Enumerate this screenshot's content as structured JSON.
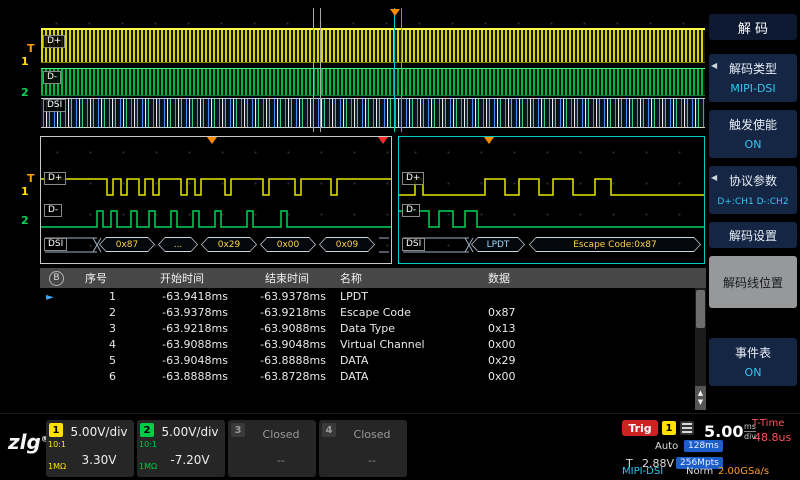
{
  "icons": {
    "scroll_up": "▲",
    "scroll_down": "▼",
    "row_pointer": "►",
    "submenu_arrow": "◀",
    "bus_badge": "B"
  },
  "wave": {
    "ch1": "D+",
    "ch2": "D-",
    "bus": "DSI",
    "t_marker": "T",
    "ch1_num": "1",
    "ch2_num": "2"
  },
  "zoom_left": {
    "ch1": "D+",
    "ch2": "D-",
    "bus": "DSI",
    "values": [
      "0x87",
      "...",
      "0x29",
      "0x00",
      "0x09"
    ]
  },
  "zoom_right": {
    "ch1": "D+",
    "ch2": "D-",
    "bus": "DSI",
    "values": [
      "LPDT",
      "Escape Code:0x87"
    ]
  },
  "table": {
    "headers": [
      "序号",
      "开始时间",
      "结束时间",
      "名称",
      "数据"
    ],
    "rows": [
      {
        "idx": "1",
        "start": "-63.9418ms",
        "end": "-63.9378ms",
        "name": "LPDT",
        "data": ""
      },
      {
        "idx": "2",
        "start": "-63.9378ms",
        "end": "-63.9218ms",
        "name": "Escape Code",
        "data": "0x87"
      },
      {
        "idx": "3",
        "start": "-63.9218ms",
        "end": "-63.9088ms",
        "name": "Data Type",
        "data": "0x13"
      },
      {
        "idx": "4",
        "start": "-63.9088ms",
        "end": "-63.9048ms",
        "name": "Virtual Channel",
        "data": "0x00"
      },
      {
        "idx": "5",
        "start": "-63.9048ms",
        "end": "-63.8888ms",
        "name": "DATA",
        "data": "0x29"
      },
      {
        "idx": "6",
        "start": "-63.8888ms",
        "end": "-63.8728ms",
        "name": "DATA",
        "data": "0x00"
      }
    ]
  },
  "sidebar": {
    "title": "解 码",
    "items": [
      {
        "label": "解码类型",
        "value": "MIPI-DSI"
      },
      {
        "label": "触发使能",
        "value": "ON"
      },
      {
        "label": "协议参数",
        "value": "D+:CH1 D-:CH2"
      },
      {
        "label": "解码设置",
        "value": ""
      },
      {
        "label": "解码线位置",
        "value": ""
      },
      {
        "label": "事件表",
        "value": "ON"
      }
    ]
  },
  "status": {
    "logo": "zlg",
    "logo_reg": "®",
    "ch1": {
      "num": "1",
      "vdiv": "5.00V/div",
      "offset": "3.30V",
      "probe": "10:1",
      "imp": "1MΩ"
    },
    "ch2": {
      "num": "2",
      "vdiv": "5.00V/div",
      "offset": "-7.20V",
      "probe": "10:1",
      "imp": "1MΩ"
    },
    "ch3": {
      "num": "3",
      "state": "Closed",
      "offset": "--"
    },
    "ch4": {
      "num": "4",
      "state": "Closed",
      "offset": "--"
    },
    "trig": {
      "label": "Trig",
      "source": "1",
      "mode": "Auto",
      "t": "T",
      "level": "2.88V",
      "badge1": "128ms",
      "badge2": "256Mpts"
    },
    "timebase": {
      "value": "5.00",
      "unit_top": "ms",
      "unit_bottom": "div"
    },
    "ttime_label": "T-Time",
    "ttime": "48.8us",
    "decode": "MIPI-DSI",
    "acq": "Norm",
    "rate": "2.00GSa/s"
  }
}
